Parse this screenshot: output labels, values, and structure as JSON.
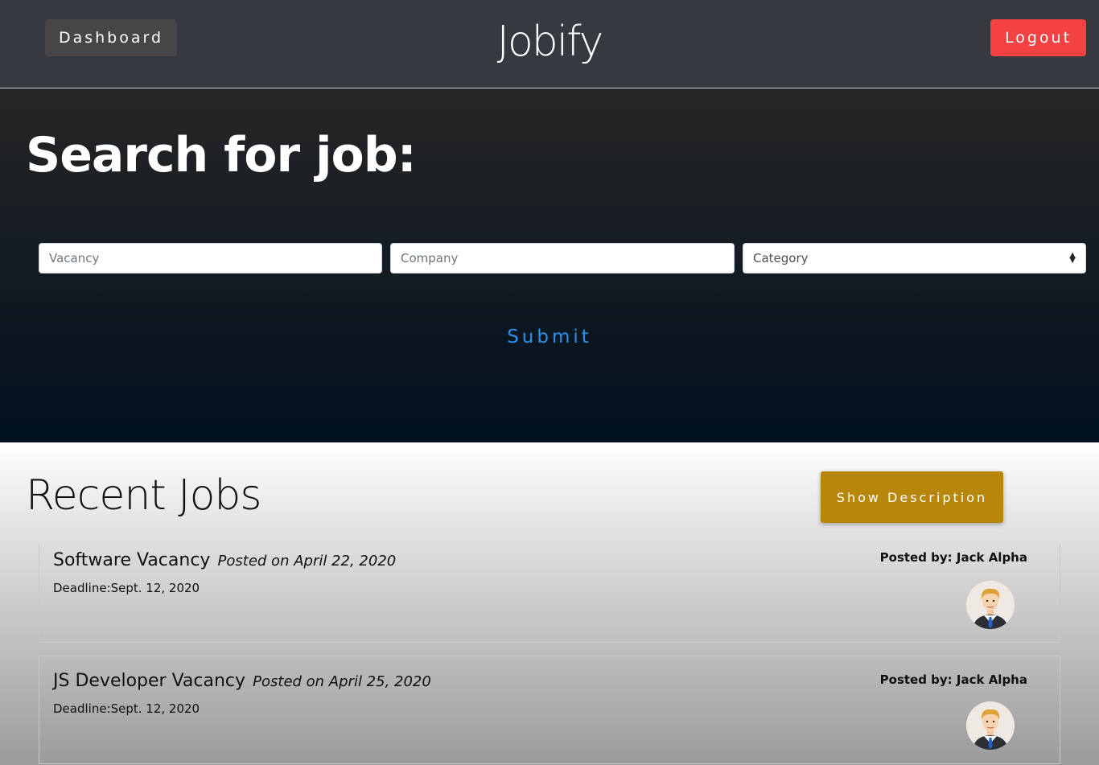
{
  "navbar": {
    "dashboard_label": "Dashboard",
    "brand": "Jobify",
    "logout_label": "Logout"
  },
  "search": {
    "title": "Search for job:",
    "vacancy_placeholder": "Vacancy",
    "company_placeholder": "Company",
    "category_selected": "Category",
    "submit_label": "Submit"
  },
  "recent": {
    "title": "Recent Jobs",
    "show_description_label": "Show Description",
    "jobs": [
      {
        "title": "Software Vacancy",
        "posted": "Posted on April 22, 2020",
        "deadline": "Deadline:Sept. 12, 2020",
        "posted_by": "Posted by: Jack Alpha",
        "avatar_icon": "businessman-avatar-icon"
      },
      {
        "title": "JS Developer Vacancy",
        "posted": "Posted on April 25, 2020",
        "deadline": "Deadline:Sept. 12, 2020",
        "posted_by": "Posted by: Jack Alpha",
        "avatar_icon": "businessman-avatar-icon"
      }
    ]
  },
  "colors": {
    "navbar_bg": "#343a40",
    "logout_bg": "#f44141",
    "submit_text": "#2d8fe8",
    "show_description_bg": "#b8860b"
  }
}
